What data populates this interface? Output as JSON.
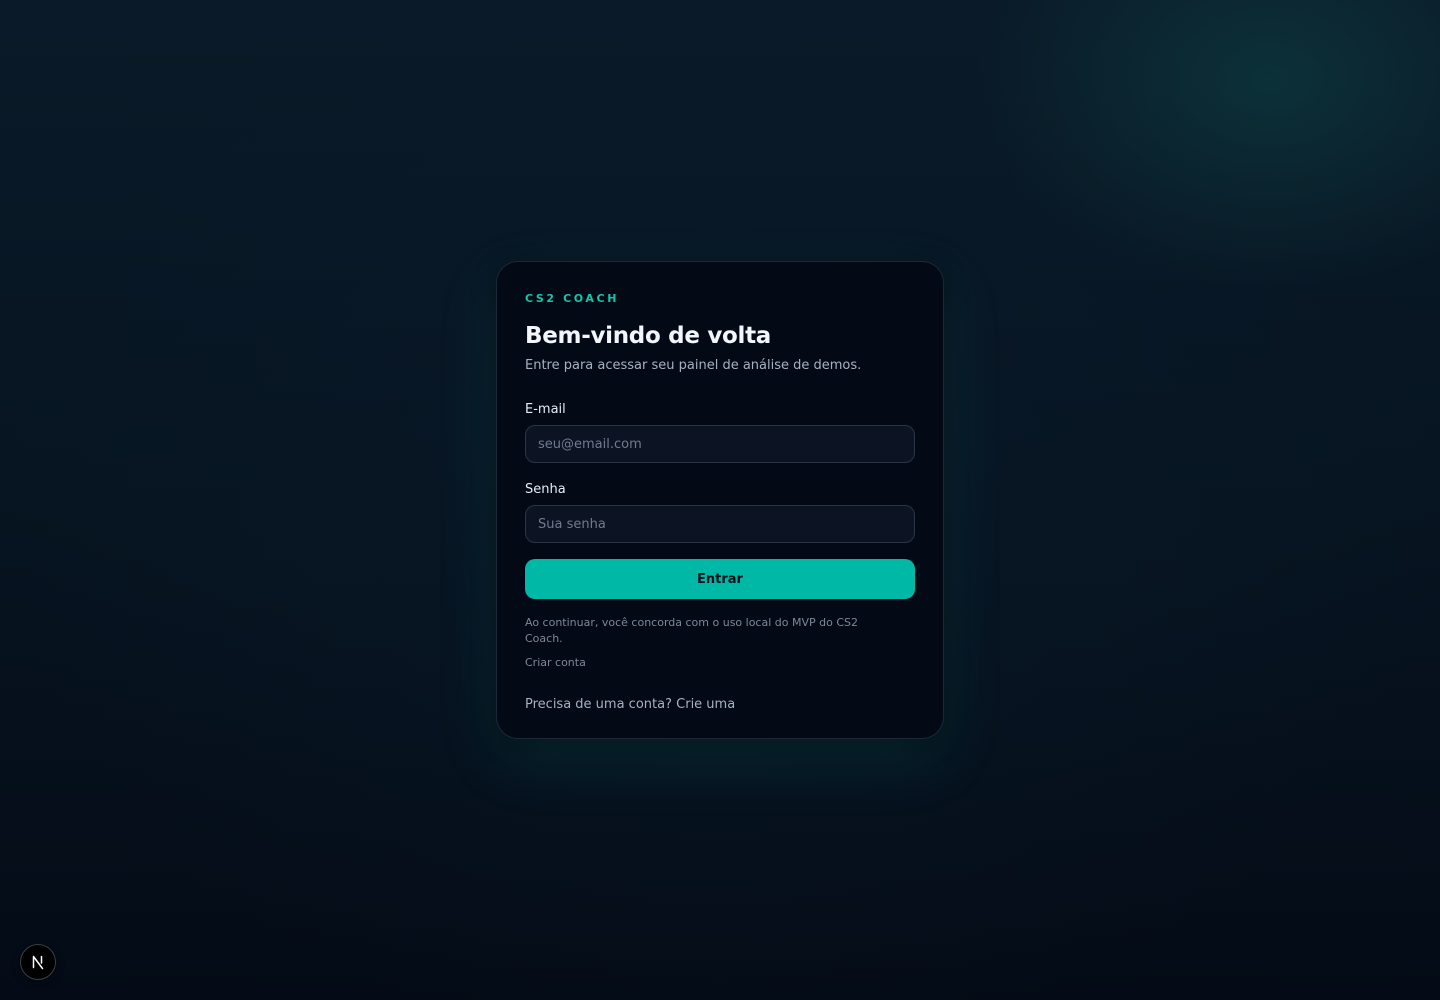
{
  "brand": "CS2 COACH",
  "login": {
    "title": "Bem-vindo de volta",
    "subtitle": "Entre para acessar seu painel de análise de demos.",
    "email_label": "E-mail",
    "email_placeholder": "seu@email.com",
    "email_value": "",
    "password_label": "Senha",
    "password_placeholder": "Sua senha",
    "password_value": "",
    "submit_label": "Entrar",
    "terms_text": "Ao continuar, você concorda com o uso local do MVP do CS2 Coach.",
    "create_account_link": "Criar conta",
    "signup_prompt": "Precisa de uma conta?",
    "signup_link": "Crie uma"
  },
  "dev_badge": {
    "icon": "nextjs-icon",
    "letter": "N"
  },
  "colors": {
    "accent": "#17c3ac",
    "button": "#00b8a6",
    "card_background": "#030a16",
    "page_background": "#071522"
  }
}
